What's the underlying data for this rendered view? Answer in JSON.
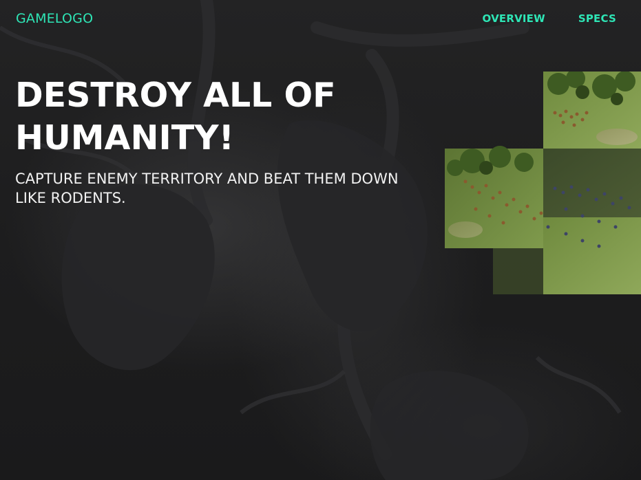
{
  "header": {
    "logo": "GAMELOGO",
    "nav": [
      {
        "label": "OVERVIEW"
      },
      {
        "label": "SPECS"
      }
    ]
  },
  "hero": {
    "title": "DESTROY ALL OF HUMANITY!",
    "subtitle": "CAPTURE ENEMY TERRITORY AND BEAT THEM DOWN LIKE RODENTS."
  },
  "colors": {
    "accent": "#2ee6b6",
    "background": "#1f1f20",
    "text": "#ffffff"
  },
  "images": {
    "background": "dark-creature-artwork",
    "screenshot": "battle-scene-mosaic"
  }
}
